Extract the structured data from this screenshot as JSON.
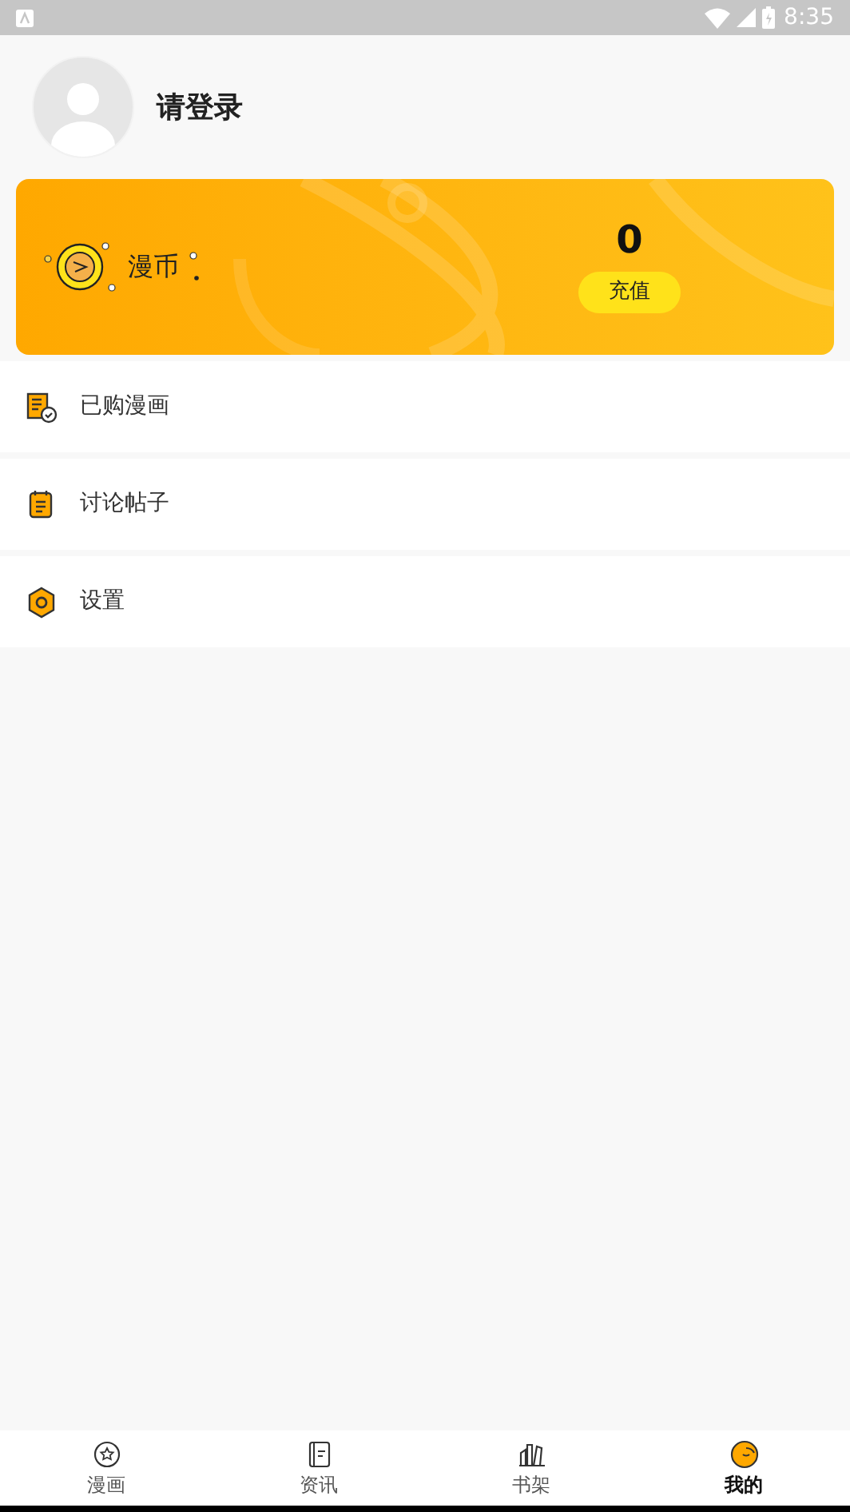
{
  "status_bar": {
    "time": "8:35"
  },
  "profile": {
    "name": "请登录"
  },
  "wallet": {
    "label": "漫币",
    "balance": "0",
    "button": "充值"
  },
  "menu": [
    {
      "kind": "purchased",
      "label": "已购漫画"
    },
    {
      "kind": "posts",
      "label": "讨论帖子"
    },
    {
      "kind": "settings",
      "label": "设置"
    }
  ],
  "tabs": [
    {
      "kind": "comics",
      "label": "漫画",
      "selected": false
    },
    {
      "kind": "news",
      "label": "资讯",
      "selected": false
    },
    {
      "kind": "shelf",
      "label": "书架",
      "selected": false
    },
    {
      "kind": "me",
      "label": "我的",
      "selected": true
    }
  ]
}
